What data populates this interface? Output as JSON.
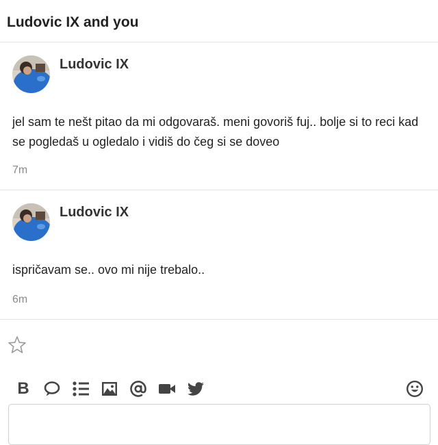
{
  "header": {
    "title": "Ludovic IX and you"
  },
  "messages": [
    {
      "author": "Ludovic IX",
      "text": "jel sam te nešt pitao da mi odgovaraš. meni govoriš fuj.. bolje si to reci kad se pogledaš u ogledalo i vidiš do čeg si se doveo",
      "time": "7m"
    },
    {
      "author": "Ludovic IX",
      "text": "ispričavam se.. ovo mi nije trebalo..",
      "time": "6m"
    }
  ],
  "actions": {
    "star_icon": "star-outline-icon"
  },
  "toolbar": {
    "bold_label": "B",
    "icons": [
      "bold-icon",
      "chat-bubble-icon",
      "list-icon",
      "image-icon",
      "at-icon",
      "video-icon",
      "twitter-icon",
      "emoji-icon"
    ]
  },
  "colors": {
    "icon": "#444444",
    "divider": "#e4e4e4",
    "timestamp": "#8a8a8a",
    "avatar_blue": "#2a6fc9"
  }
}
